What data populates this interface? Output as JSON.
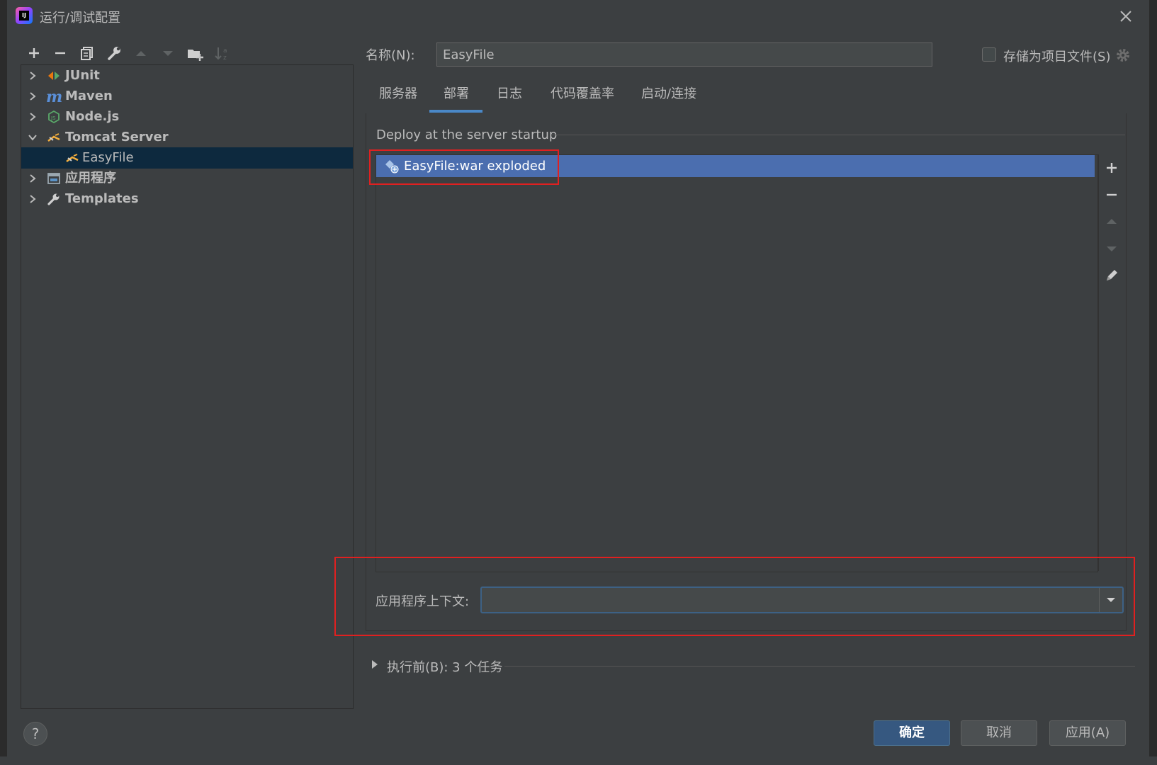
{
  "window": {
    "title": "运行/调试配置"
  },
  "toolbar": {
    "buttons": [
      "add-icon",
      "remove-icon",
      "copy-icon",
      "wrench-icon",
      "move-up-icon",
      "move-down-icon",
      "new-folder-icon",
      "sort-icon"
    ]
  },
  "tree": {
    "items": [
      {
        "label": "JUnit",
        "icon": "junit-icon",
        "expanded": false
      },
      {
        "label": "Maven",
        "icon": "maven-icon",
        "expanded": false
      },
      {
        "label": "Node.js",
        "icon": "nodejs-icon",
        "expanded": false
      },
      {
        "label": "Tomcat Server",
        "icon": "tomcat-icon",
        "expanded": true
      },
      {
        "label": "EasyFile",
        "icon": "tomcat-icon",
        "selected": true
      },
      {
        "label": "应用程序",
        "icon": "application-icon",
        "expanded": false
      },
      {
        "label": "Templates",
        "icon": "wrench-icon",
        "expanded": false
      }
    ]
  },
  "name_field": {
    "label": "名称(N):",
    "value": "EasyFile"
  },
  "store_as_project": {
    "label": "存储为项目文件(S)",
    "checked": false
  },
  "tabs": [
    {
      "label": "服务器",
      "active": false
    },
    {
      "label": "部署",
      "active": true
    },
    {
      "label": "日志",
      "active": false
    },
    {
      "label": "代码覆盖率",
      "active": false
    },
    {
      "label": "启动/连接",
      "active": false
    }
  ],
  "deploy": {
    "section_title": "Deploy at the server startup",
    "items": [
      {
        "label": "EasyFile:war exploded",
        "icon": "artifact-icon",
        "selected": true
      }
    ],
    "side_buttons": [
      "add-icon",
      "remove-icon",
      "move-up-icon",
      "move-down-icon",
      "edit-icon"
    ]
  },
  "context": {
    "label": "应用程序上下文:",
    "value": ""
  },
  "before_launch": {
    "label": "执行前(B): 3 个任务"
  },
  "buttons": {
    "ok": "确定",
    "cancel": "取消",
    "apply": "应用(A)"
  },
  "help": {
    "label": "?"
  },
  "colors": {
    "background": "#3c3f41",
    "selection": "#4b6eaf",
    "tree_selection": "#0d293e",
    "accent": "#4a88c7",
    "highlight": "#e02020",
    "primary_button": "#365880"
  }
}
